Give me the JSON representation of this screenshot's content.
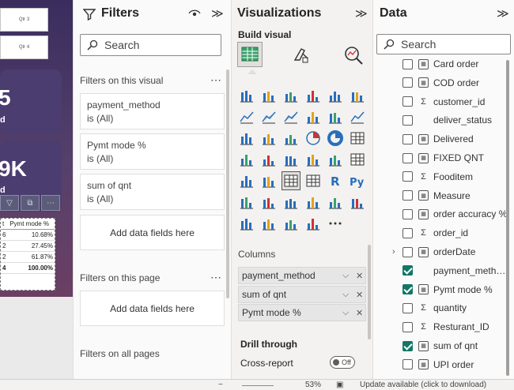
{
  "canvas": {
    "qtr_buttons": [
      "Qtr 3",
      "Qtr 4"
    ],
    "kpi_values": [
      "5",
      "d",
      "9K",
      "d"
    ],
    "table": {
      "header": [
        "t",
        "Pymt mode %"
      ],
      "rows": [
        [
          "6",
          "10.68%"
        ],
        [
          "2",
          "27.45%"
        ],
        [
          "2",
          "61.87%"
        ]
      ],
      "total": [
        "4",
        "100.00%"
      ]
    }
  },
  "filters": {
    "title": "Filters",
    "section_visual": "Filters on this visual",
    "cards": [
      {
        "field": "payment_method",
        "state": "is (All)"
      },
      {
        "field": "Pymt mode %",
        "state": "is (All)"
      },
      {
        "field": "sum of qnt",
        "state": "is (All)"
      }
    ],
    "add_fields": "Add data fields here",
    "section_page": "Filters on this page",
    "section_all": "Filters on all pages",
    "search_placeholder": "Search"
  },
  "viz": {
    "title": "Visualizations",
    "build_visual": "Build visual",
    "columns_label": "Columns",
    "columns": [
      "payment_method",
      "sum of qnt",
      "Pymt mode %"
    ],
    "drill_through": "Drill through",
    "cross_report": "Cross-report",
    "toggle_label": "Off"
  },
  "data": {
    "title": "Data",
    "search_placeholder": "Search",
    "fields": [
      {
        "name": "Card order",
        "type": "calc",
        "checked": false
      },
      {
        "name": "COD order",
        "type": "calc",
        "checked": false
      },
      {
        "name": "customer_id",
        "type": "sum",
        "checked": false
      },
      {
        "name": "deliver_status",
        "type": "none",
        "checked": false
      },
      {
        "name": "Delivered",
        "type": "calc",
        "checked": false
      },
      {
        "name": "FIXED QNT",
        "type": "calc",
        "checked": false
      },
      {
        "name": "Fooditem",
        "type": "sum",
        "checked": false
      },
      {
        "name": "Measure",
        "type": "calc",
        "checked": false
      },
      {
        "name": "order accuracy %",
        "type": "calc",
        "checked": false
      },
      {
        "name": "order_id",
        "type": "sum",
        "checked": false
      },
      {
        "name": "orderDate",
        "type": "calc",
        "checked": false,
        "expandable": true
      },
      {
        "name": "payment_meth…",
        "type": "none",
        "checked": true
      },
      {
        "name": "Pymt mode %",
        "type": "calc",
        "checked": true
      },
      {
        "name": "quantity",
        "type": "sum",
        "checked": false
      },
      {
        "name": "Resturant_ID",
        "type": "sum",
        "checked": false
      },
      {
        "name": "sum of qnt",
        "type": "calc",
        "checked": true
      },
      {
        "name": "UPI order",
        "type": "calc",
        "checked": false
      }
    ]
  },
  "status_bar": {
    "zoom": "53%",
    "update": "Update available (click to download)"
  },
  "colors": {
    "accent_green": "#117865",
    "canvas_bg": "#3a2d5e",
    "pane_bg": "#f3f2f1"
  }
}
